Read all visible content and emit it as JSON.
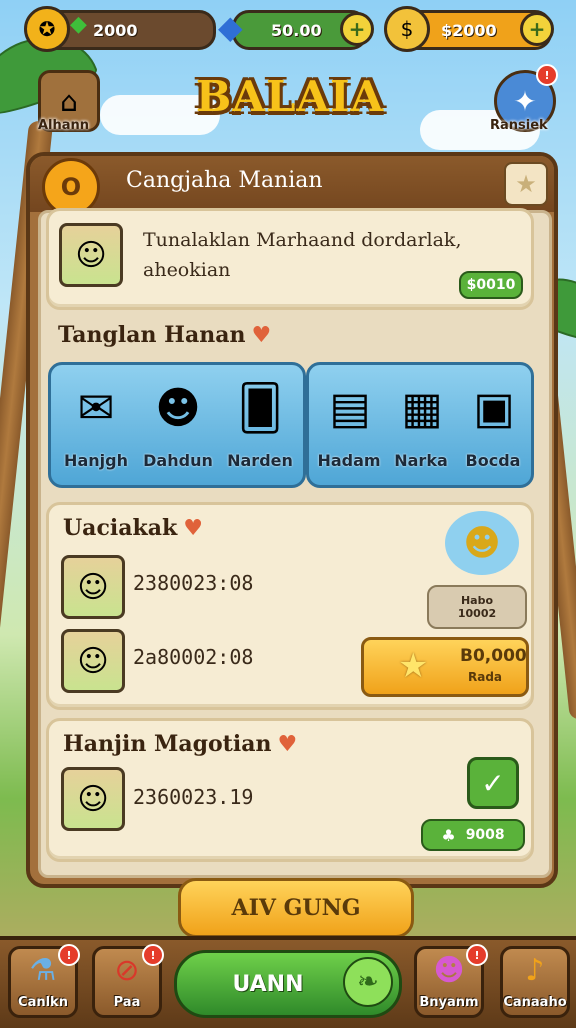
{
  "topbar": {
    "gems": {
      "value": "2000",
      "icon": "gem-icon"
    },
    "energy": {
      "value": "50.00",
      "icon": "diamond-icon"
    },
    "coins": {
      "value": "$2000",
      "icon": "coin-icon"
    },
    "plus": "+"
  },
  "corner": {
    "left_label": "Alhann",
    "right_label": "Ransiek",
    "right_badge": "!"
  },
  "title": "BALAIA",
  "panel": {
    "badge": "O",
    "title": "Cangjaha Manian",
    "intro": {
      "text_line1": "Tunalaklan Marhaand dordarlak,",
      "text_line2": "aheokian",
      "price": "$0010"
    },
    "section1": {
      "title": "Tanglan Hanan",
      "group_a": [
        {
          "label": "Hanjgh",
          "icon": "paper-plane-icon"
        },
        {
          "label": "Dahdun",
          "icon": "character-icon"
        },
        {
          "label": "Narden",
          "icon": "card-icon"
        }
      ],
      "group_b": [
        {
          "label": "Hadam",
          "icon": "book-stack-icon"
        },
        {
          "label": "Narka",
          "icon": "ticket-icon"
        },
        {
          "label": "Bocda",
          "icon": "board-icon"
        }
      ]
    },
    "section2": {
      "title": "Uaciakak",
      "rows": [
        {
          "time": "2380023:08"
        },
        {
          "time": "2a80002:08"
        }
      ],
      "small_btn_line1": "Habo",
      "small_btn_line2": "10002",
      "reward_line1": "B0,000",
      "reward_line2": "Rada"
    },
    "section3": {
      "title": "Hanjin Magotian",
      "rows": [
        {
          "time": "2360023.19"
        }
      ],
      "amount": "9008"
    },
    "main_button": "AIV GUNG"
  },
  "bottom_nav": [
    {
      "label": "Canlkn",
      "icon": "potion-icon",
      "badge": "!"
    },
    {
      "label": "Paa",
      "icon": "forbidden-icon",
      "badge": "!"
    },
    {
      "label": "UANN",
      "icon": "leaf-icon"
    },
    {
      "label": "Bnyanm",
      "icon": "character-icon",
      "badge": "!"
    },
    {
      "label": "Canaaho",
      "icon": "microphone-icon"
    }
  ]
}
